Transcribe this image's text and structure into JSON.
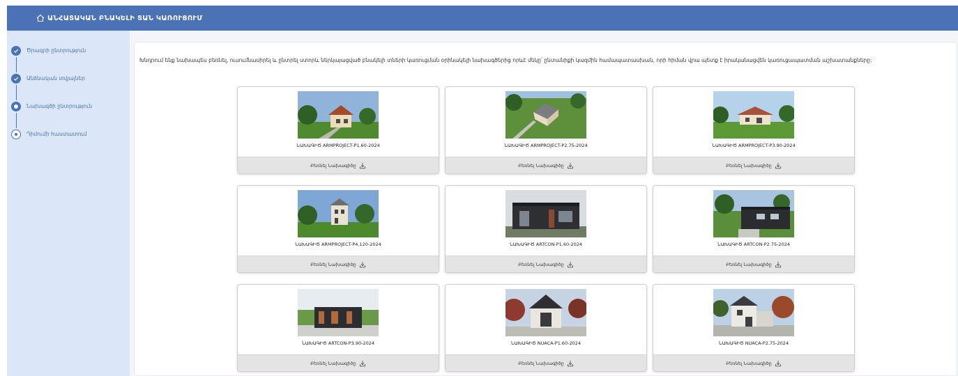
{
  "header": {
    "title": "ԱՆՀԱՏԱԿԱՆ ԲՆԱԿԵԼԻ ՏԱՆ ԿԱՌՈՒՑՈՒՄ",
    "icon": "home-icon"
  },
  "sidebar": {
    "steps": [
      {
        "label": "Ծրագրի ընտրություն",
        "status": "done"
      },
      {
        "label": "Անձնական տվյալներ",
        "status": "done"
      },
      {
        "label": "Նախագծի ընտրություն",
        "status": "current"
      },
      {
        "label": "Դիմումի հաստատում",
        "status": "todo"
      }
    ]
  },
  "intro": "Խնդրում ենք նախապես բեռնել, ուսումնասիրել և ընտրել ստորև ներկայացված բնակելի տների կառուցման օրինակելի նախագծերից որևէ մեկը՝ ընտանիքի կազմին համապատասխան, որի հիման վրա պետք է իրականացվեն կառուցապատման աշխատանքները:",
  "download_label": "Բեռնել Նախագիծը",
  "colors": {
    "accent": "#4a72b5",
    "sidebar_bg": "#dbe7f8"
  },
  "projects": [
    {
      "name": "ՆԱԽԱԳԻԾ ARMPROJECT-P1.60-2024"
    },
    {
      "name": "ՆԱԽԱԳԻԾ ARMPROJECT-P2.75-2024"
    },
    {
      "name": "ՆԱԽԱԳԻԾ ARMPROJECT-P3.90-2024"
    },
    {
      "name": "ՆԱԽԱԳԻԾ ARMPROJECT-P4.120-2024"
    },
    {
      "name": "ՆԱԽԱԳԻԾ ARTCON-P1.60-2024"
    },
    {
      "name": "ՆԱԽԱԳԻԾ ARTCON-P2.75-2024"
    },
    {
      "name": "ՆԱԽԱԳԻԾ ARTCON-P3.90-2024"
    },
    {
      "name": "ՆԱԽԱԳԻԾ NUACA-P1.60-2024"
    },
    {
      "name": "ՆԱԽԱԳԻԾ NUACA-P2.75-2024"
    }
  ]
}
